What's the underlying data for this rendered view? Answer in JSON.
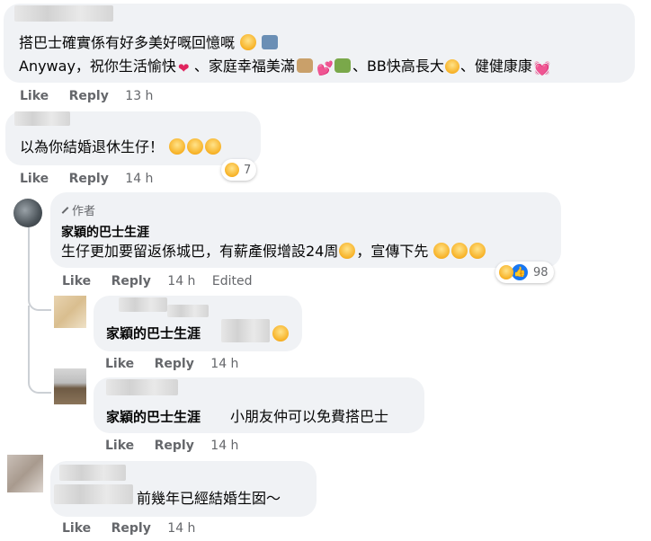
{
  "comments": [
    {
      "line1": "搭巴士確實係有好多美好嘅回憶嘅",
      "line2a": "Anyway，祝你生活愉快",
      "line2b": "、家庭幸福美滿",
      "line2c": "、BB快高長大",
      "line2d": "、健健康康",
      "like": "Like",
      "reply": "Reply",
      "time": "13 h"
    },
    {
      "text": "以為你結婚退休生仔！",
      "reactions": "7",
      "like": "Like",
      "reply": "Reply",
      "time": "14 h"
    },
    {
      "badge": "作者",
      "author": "家穎的巴士生涯",
      "text": "生仔更加要留返係城巴，有薪產假增設24周",
      "text2": "，宣傳下先",
      "reactions": "98",
      "like": "Like",
      "reply": "Reply",
      "time": "14 h",
      "edited": "Edited"
    },
    {
      "mention": "家穎的巴士生涯",
      "like": "Like",
      "reply": "Reply",
      "time": "14 h"
    },
    {
      "mention": "家穎的巴士生涯",
      "text": "小朋友仲可以免費搭巴士",
      "like": "Like",
      "reply": "Reply",
      "time": "14 h"
    },
    {
      "text": "前幾年已經結婚生囡～",
      "like": "Like",
      "reply": "Reply",
      "time": "14 h"
    }
  ],
  "icons": {
    "pencil": "pencil-icon",
    "like": "👍"
  },
  "colors": {
    "bubble": "#f0f2f5",
    "meta": "#65676b",
    "like_blue": "#1877f2"
  }
}
